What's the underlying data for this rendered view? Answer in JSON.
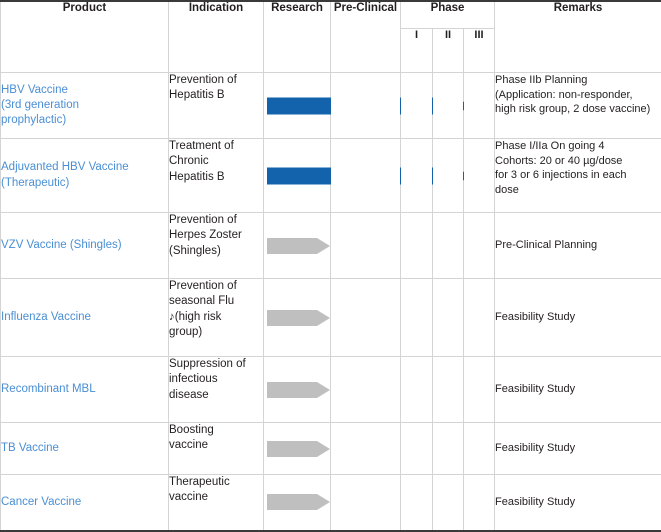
{
  "table": {
    "headers": {
      "product": "Product",
      "indication": "Indication",
      "research": "Research",
      "preclinical": "Pre-Clinical",
      "phase": "Phase",
      "phase_1": "I",
      "phase_2": "II",
      "phase_3": "III",
      "remarks": "Remarks"
    },
    "colors": {
      "product_text": "#4a8fd4",
      "arrow_blue": "#1263ac",
      "arrow_grey": "#bfbfbf",
      "border": "#d4d4d4",
      "border_strong": "#3a3a3a",
      "text": "#231f20"
    },
    "rows": [
      {
        "product": "HBV Vaccine\n(3rd generation\nprophylactic)",
        "indication": "Prevention of\nHepatitis B",
        "arrow": {
          "kind": "blue",
          "start_stage": "research",
          "end_stage": "phase-III"
        },
        "remarks": "Phase IIb Planning\n(Application: non-responder,\nhigh risk group, 2 dose vaccine)"
      },
      {
        "product": "Adjuvanted HBV Vaccine\n(Therapeutic)",
        "indication": "Treatment of\nChronic\nHepatitis B",
        "arrow": {
          "kind": "blue",
          "start_stage": "research",
          "end_stage": "phase-III"
        },
        "remarks": "Phase I/IIa On going 4\nCohorts: 20 or 40 µg/dose\nfor 3 or 6 injections in each\ndose"
      },
      {
        "product": "VZV Vaccine (Shingles)",
        "indication": "Prevention of\nHerpes Zoster\n(Shingles)",
        "arrow": {
          "kind": "grey",
          "start_stage": "research",
          "end_stage": "research"
        },
        "remarks": "Pre-Clinical Planning"
      },
      {
        "product": "Influenza Vaccine",
        "indication": "Prevention of\nseasonal Flu\n♪(high risk\ngroup)",
        "arrow": {
          "kind": "grey",
          "start_stage": "research",
          "end_stage": "research"
        },
        "remarks": "Feasibility Study"
      },
      {
        "product": "Recombinant MBL",
        "indication": "Suppression of\ninfectious\ndisease",
        "arrow": {
          "kind": "grey",
          "start_stage": "research",
          "end_stage": "research"
        },
        "remarks": "Feasibility Study"
      },
      {
        "product": "TB Vaccine",
        "indication": "Boosting\nvaccine",
        "arrow": {
          "kind": "grey",
          "start_stage": "research",
          "end_stage": "research"
        },
        "remarks": "Feasibility Study"
      },
      {
        "product": "Cancer Vaccine",
        "indication": "Therapeutic\nvaccine",
        "arrow": {
          "kind": "grey",
          "start_stage": "research",
          "end_stage": "research"
        },
        "remarks": "Feasibility Study"
      }
    ]
  }
}
